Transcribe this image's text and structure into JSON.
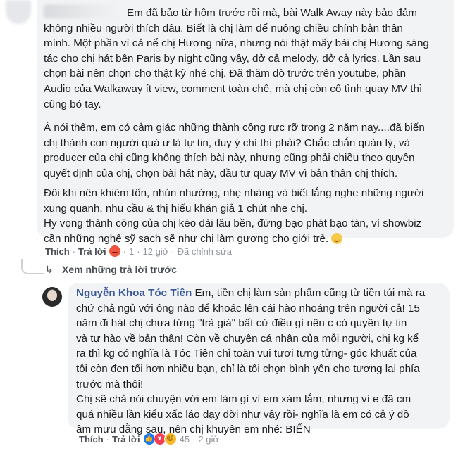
{
  "comment": {
    "paragraph1": "Em đã bảo từ hôm trước rồi mà, bài Walk Away này bảo đảm\nkhông nhiều người thích đâu. Biết là chị làm để nuông chiều chính bản thân\nmình. Một phần vì cả nể chị Hương nữa, nhưng nói thật mấy bài chị Hương sáng\ntác cho chị hát bên Paris by night cũng vậy, dở cả melody, dở cả lyrics. Lần sau\nchọn bài nên chọn cho thật kỹ nhé chị. Đã thăm dò trước trên youtube, phần\nAudio của Walkaway ít view, comment toàn chê, mà chị còn cố tình quay MV thì\ncũng bó tay.",
    "paragraph2": "À nói thêm, em có cảm giác những thành công rực rỡ trong 2 năm nay....đã biến\nchị thành con người quá ư là tự tin, duy ý chí thì phải? Chắc chắn quản lý, và\nproducer của chị cũng không thích bài này, nhưng cũng phải chiều theo quyền\nquyết định của chị, chọn bài hát này, đầu tư quay MV vì bản thân chị thích.",
    "paragraph3": "Đôi khi nên khiêm tốn, nhún nhường, nhẹ nhàng và biết lắng nghe những người\nxung quanh, nhu cầu & thị hiếu khán giả 1 chút nhe chị.\nHy vọng thành công của chị kéo dài lâu bền, đừng bạo phát bạo tàn, vì showbiz\ncần những nghệ sỹ sạch sẽ như chị làm gương cho giới trẻ.",
    "actions": {
      "like": "Thích",
      "reply": "Trả lời",
      "reaction_count": "1",
      "time": "12 giờ",
      "edited": "Đã chỉnh sửa"
    }
  },
  "view_previous": "Xem những trả lời trước",
  "reply": {
    "author": "Nguyễn Khoa Tóc Tiên",
    "text": "Em, tiền chị làm sản phẩm cũng từ tiền túi mà ra\nchứ chả ngủ với ông nào để khoác lên cái hào nhoáng trên người cả! 15\nnăm đi hát chị chưa từng \"trả giá\" bất cứ điều gì nên c có quyền tự tin\nvà tự hào về bản thân! Còn về chuyện cá nhân của mỗi người, chị kg kể\nra thì kg có nghĩa là Tóc Tiên chỉ toàn vui tươi tưng tửng- góc khuất của\ntôi còn đen tối hơn nhiều bạn, chỉ là tôi chọn bình yên cho tương lai phía\ntrước mà thôi!\nChị sẽ chả nói chuyện với em làm gì vì em xàm lắm, nhưng vì e đã cm\nquá nhiều lần kiểu xấc láo dạy đời như vậy rồi- nghĩa là em có cả ý đồ\nâm mưu đằng sau, nên chị khuyên em nhé: BIẾN",
    "actions": {
      "like": "Thích",
      "reply": "Trả lời",
      "reaction_count": "45",
      "time": "2 giờ"
    }
  }
}
